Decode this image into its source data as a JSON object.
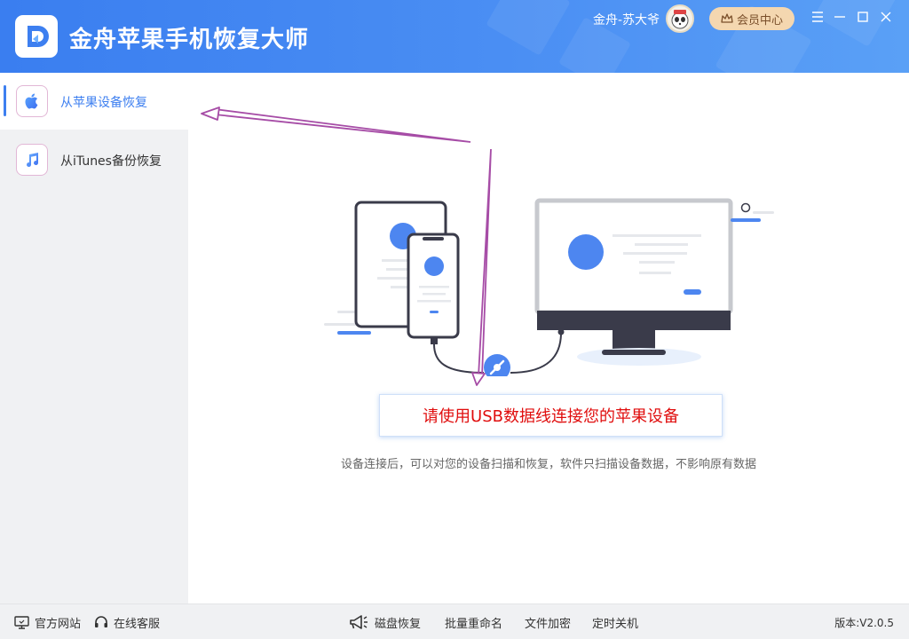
{
  "header": {
    "title": "金舟苹果手机恢复大师",
    "user_name": "金舟-苏大爷",
    "vip_label": "会员中心"
  },
  "sidebar": {
    "items": [
      {
        "label": "从苹果设备恢复",
        "icon": "apple-icon",
        "active": true
      },
      {
        "label": "从iTunes备份恢复",
        "icon": "music-note-icon",
        "active": false
      }
    ]
  },
  "main": {
    "connect_prompt": "请使用USB数据线连接您的苹果设备",
    "hint": "设备连接后，可以对您的设备扫描和恢复，软件只扫描设备数据，不影响原有数据"
  },
  "footer": {
    "left": [
      {
        "label": "官方网站",
        "icon": "monitor-icon"
      },
      {
        "label": "在线客服",
        "icon": "headset-icon"
      }
    ],
    "tools": [
      {
        "label": "磁盘恢复",
        "icon": "megaphone-icon"
      },
      {
        "label": "批量重命名"
      },
      {
        "label": "文件加密"
      },
      {
        "label": "定时关机"
      }
    ],
    "version": "版本:V2.0.5"
  },
  "colors": {
    "header_start": "#3a7ef0",
    "header_end": "#5aa0f6",
    "accent": "#3d7ff0",
    "prompt_red": "#e00d0d",
    "annotation_arrow": "#a64ca6",
    "vip_bg": "#f4d7b0"
  }
}
